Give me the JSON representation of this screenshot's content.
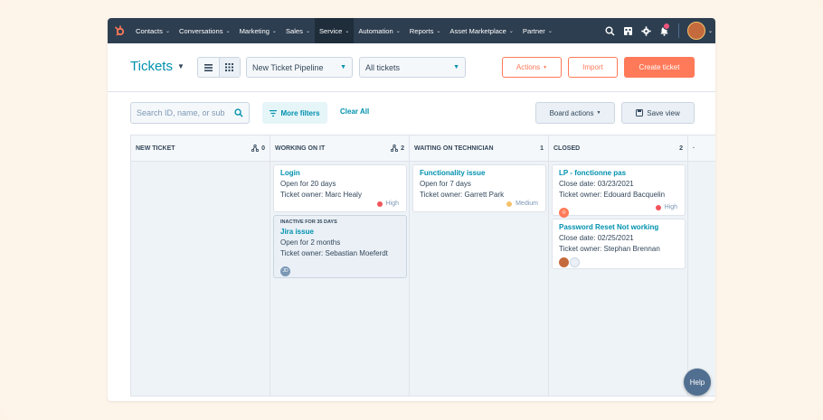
{
  "nav": {
    "items": [
      {
        "label": "Contacts",
        "active": false
      },
      {
        "label": "Conversations",
        "active": false
      },
      {
        "label": "Marketing",
        "active": false
      },
      {
        "label": "Sales",
        "active": false
      },
      {
        "label": "Service",
        "active": true
      },
      {
        "label": "Automation",
        "active": false
      },
      {
        "label": "Reports",
        "active": false
      },
      {
        "label": "Asset Marketplace",
        "active": false
      },
      {
        "label": "Partner",
        "active": false
      }
    ],
    "chevron": "⌄",
    "icons": [
      "search-icon",
      "marketplace-icon",
      "settings-icon",
      "notifications-icon",
      "avatar"
    ]
  },
  "header": {
    "title": "Tickets",
    "pipeline": "New Ticket Pipeline",
    "view": "All tickets",
    "actions_label": "Actions",
    "import_label": "Import",
    "create_label": "Create ticket"
  },
  "filters": {
    "search_placeholder": "Search ID, name, or sub",
    "more_filters": "More filters",
    "clear_all": "Clear All",
    "board_actions": "Board actions",
    "save_view": "Save view"
  },
  "columns": [
    {
      "title": "NEW TICKET",
      "count": "0"
    },
    {
      "title": "WORKING ON IT",
      "count": "2"
    },
    {
      "title": "WAITING ON TECHNICIAN",
      "count": "1"
    },
    {
      "title": "CLOSED",
      "count": "2"
    }
  ],
  "cards": {
    "working": [
      {
        "name": "Login",
        "line1": "Open for 20 days",
        "line2": "Ticket owner: Marc Healy",
        "priority": "High"
      },
      {
        "inactive": "INACTIVE FOR 35 DAYS",
        "name": "Jira issue",
        "line1": "Open for 2 months",
        "line2": "Ticket owner: Sebastian Moeferdt",
        "avatar": "JD"
      }
    ],
    "waiting": [
      {
        "name": "Functionality issue",
        "line1": "Open for 7 days",
        "line2": "Ticket owner: Garrett Park",
        "priority": "Medium"
      }
    ],
    "closed": [
      {
        "name": "LP - fonctionne pas",
        "line1": "Close date: 03/23/2021",
        "line2": "Ticket owner: Edouard Bacquelin",
        "priority": "High"
      },
      {
        "name": "Password Reset Not working",
        "line1": "Close date: 02/25/2021",
        "line2": "Ticket owner: Stephan Brennan"
      }
    ]
  },
  "help_label": "Help",
  "colors": {
    "brand": "#ff7a59",
    "nav": "#2d3e50",
    "link": "#0091ae",
    "high": "#f2545b",
    "medium": "#f5c26b"
  }
}
